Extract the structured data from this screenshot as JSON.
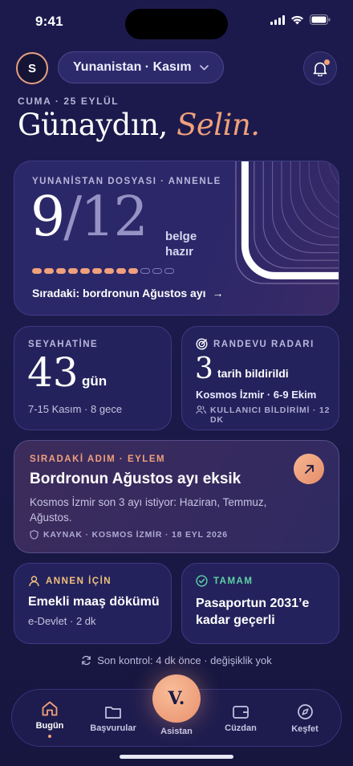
{
  "status": {
    "time": "9:41"
  },
  "header": {
    "avatar_initial": "S",
    "trip_selector": "Yunanistan · Kasım",
    "date_line": "CUMA · 25 EYLÜL",
    "greeting_prefix": "Günaydın,",
    "greeting_name": "Selin."
  },
  "hero": {
    "label": "YUNANİSTAN DOSYASI · ANNENLE",
    "done": "9",
    "slash": "/",
    "total": "12",
    "unit_line1": "belge",
    "unit_line2": "hazır",
    "progress": {
      "done": 9,
      "total": 12
    },
    "next": "Sıradaki: bordronun Ağustos ayı",
    "next_arrow": "→"
  },
  "trip": {
    "label": "SEYAHATİNE",
    "days": "43",
    "days_unit": "gün",
    "dates": "7-15 Kasım · 8 gece"
  },
  "radar": {
    "label": "RANDEVU RADARI",
    "count": "3",
    "count_text": "tarih bildirildi",
    "location": "Kosmos İzmir · 6-9 Ekim",
    "reports": "KULLANICI BİLDİRİMİ · 12 DK"
  },
  "action": {
    "label": "SIRADAKİ ADIM · EYLEM",
    "title": "Bordronun Ağustos ayı eksik",
    "desc": "Kosmos İzmir son 3 ayı istiyor: Haziran, Temmuz, Ağustos.",
    "source": "KAYNAK · KOSMOS İZMİR · 18 EYL 2026"
  },
  "mom": {
    "label": "ANNEN İÇİN",
    "title": "Emekli maaş dökümü",
    "sub": "e-Devlet · 2 dk"
  },
  "ok": {
    "label": "TAMAM",
    "title_line1": "Pasaportun 2031’e",
    "title_line2": "kadar geçerli"
  },
  "last_check": "Son kontrol: 4 dk önce · değişiklik yok",
  "tabs": {
    "home": "Bugün",
    "applications": "Başvurular",
    "assistant": "Asistan",
    "assistant_mark": "V.",
    "wallet": "Cüzdan",
    "explore": "Keşfet"
  },
  "colors": {
    "accent": "#f0a07c",
    "background": "#1c1a4d",
    "card": "#24225c",
    "success": "#5fd3a6"
  }
}
